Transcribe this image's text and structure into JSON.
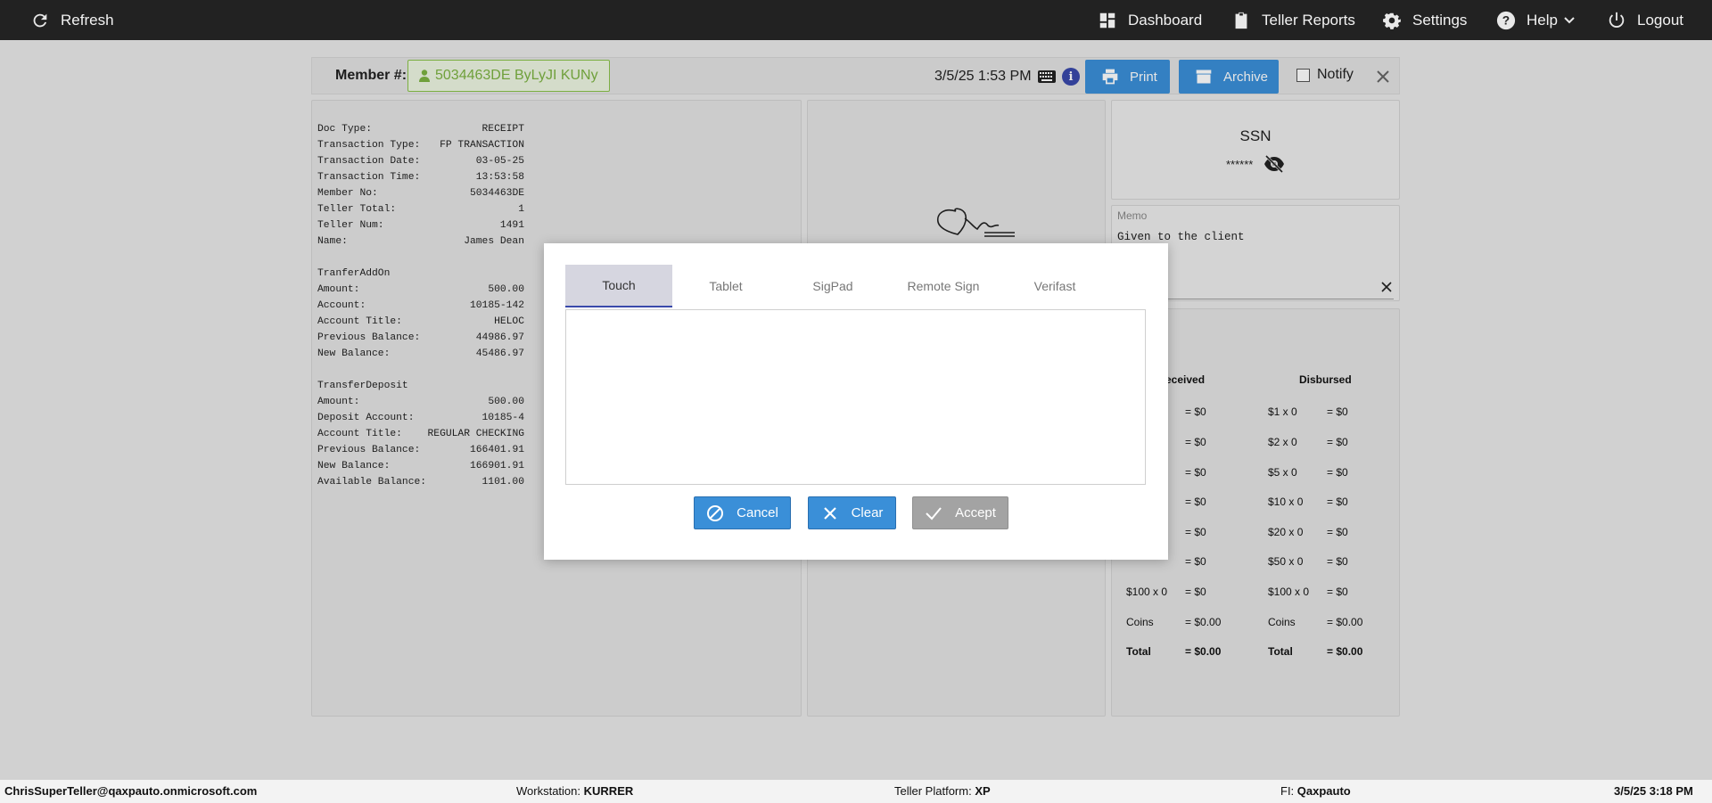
{
  "topbar": {
    "refresh_label": "Refresh",
    "dashboard_label": "Dashboard",
    "teller_reports_label": "Teller Reports",
    "settings_label": "Settings",
    "help_label": "Help",
    "logout_label": "Logout"
  },
  "member_bar": {
    "label": "Member #:",
    "member_value": "5034463DE ByLyJI KUNy",
    "datetime": "3/5/25 1:53 PM",
    "print_label": "Print",
    "archive_label": "Archive",
    "notify_label": "Notify"
  },
  "receipt": {
    "lines": [
      {
        "k": "Doc Type:",
        "v": "RECEIPT"
      },
      {
        "k": "Transaction Type:",
        "v": "FP TRANSACTION"
      },
      {
        "k": "Transaction Date:",
        "v": "03-05-25"
      },
      {
        "k": "Transaction Time:",
        "v": "13:53:58"
      },
      {
        "k": "Member No:",
        "v": "5034463DE"
      },
      {
        "k": "Teller Total:",
        "v": "1"
      },
      {
        "k": "Teller Num:",
        "v": "1491"
      },
      {
        "k": "Name:",
        "v": "James Dean"
      },
      {
        "k": "",
        "v": ""
      },
      {
        "k": "TranferAddOn",
        "v": ""
      },
      {
        "k": "Amount:",
        "v": "500.00"
      },
      {
        "k": "Account:",
        "v": "10185-142"
      },
      {
        "k": "Account Title:",
        "v": "HELOC"
      },
      {
        "k": "Previous Balance:",
        "v": "44986.97"
      },
      {
        "k": "New Balance:",
        "v": "45486.97"
      },
      {
        "k": "",
        "v": ""
      },
      {
        "k": "TransferDeposit",
        "v": ""
      },
      {
        "k": "Amount:",
        "v": "500.00"
      },
      {
        "k": "Deposit Account:",
        "v": "10185-4"
      },
      {
        "k": "Account Title:",
        "v": "REGULAR CHECKING"
      },
      {
        "k": "Previous Balance:",
        "v": "166401.91"
      },
      {
        "k": "New Balance:",
        "v": "166901.91"
      },
      {
        "k": "Available Balance:",
        "v": "1101.00"
      }
    ]
  },
  "ssn": {
    "title": "SSN",
    "masked": "******"
  },
  "memo": {
    "label": "Memo",
    "text": "Given to the client"
  },
  "cash": {
    "received_header": "eceived",
    "disbursed_header": "Disbursed",
    "received": [
      {
        "denom": "",
        "val": "= $0"
      },
      {
        "denom": "",
        "val": "= $0"
      },
      {
        "denom": "",
        "val": "= $0"
      },
      {
        "denom": "",
        "val": "= $0"
      },
      {
        "denom": "",
        "val": "= $0"
      },
      {
        "denom": "",
        "val": "= $0"
      },
      {
        "denom": "$100 x 0",
        "val": "= $0"
      },
      {
        "denom": "Coins",
        "val": "= $0.00"
      },
      {
        "denom": "Total",
        "val": "= $0.00"
      }
    ],
    "disbursed": [
      {
        "denom": "$1 x 0",
        "val": "= $0"
      },
      {
        "denom": "$2 x 0",
        "val": "= $0"
      },
      {
        "denom": "$5 x 0",
        "val": "= $0"
      },
      {
        "denom": "$10 x 0",
        "val": "= $0"
      },
      {
        "denom": "$20 x 0",
        "val": "= $0"
      },
      {
        "denom": "$50 x 0",
        "val": "= $0"
      },
      {
        "denom": "$100 x 0",
        "val": "= $0"
      },
      {
        "denom": "Coins",
        "val": "= $0.00"
      },
      {
        "denom": "Total",
        "val": "= $0.00"
      }
    ]
  },
  "modal": {
    "tabs": [
      "Touch",
      "Tablet",
      "SigPad",
      "Remote Sign",
      "Verifast"
    ],
    "active_tab": "Touch",
    "cancel_label": "Cancel",
    "clear_label": "Clear",
    "accept_label": "Accept"
  },
  "footer": {
    "user": "ChrisSuperTeller@qaxpauto.onmicrosoft.com",
    "workstation_label": "Workstation:",
    "workstation": "KURRER",
    "platform_label": "Teller Platform:",
    "platform": "XP",
    "fi_label": "FI:",
    "fi": "Qaxpauto",
    "datetime": "3/5/25 3:18 PM"
  },
  "colors": {
    "topbar": "#222222",
    "accent_blue": "#3a8fd8",
    "member_green": "#7cb342",
    "tab_indicator": "#3949ab"
  }
}
